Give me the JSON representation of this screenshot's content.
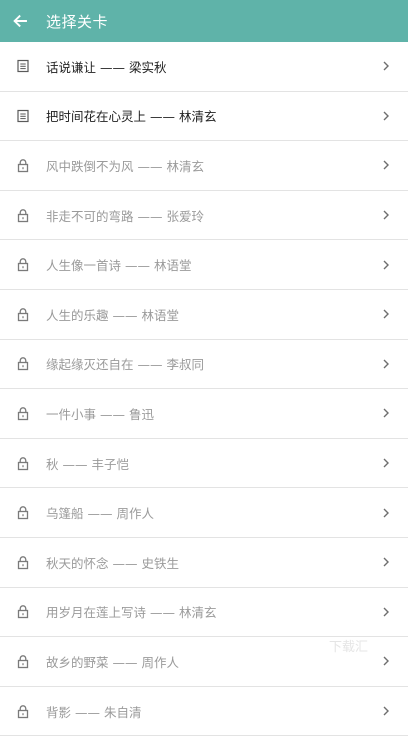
{
  "header": {
    "title": "选择关卡",
    "bg_color": "#5fb3a9"
  },
  "levels": [
    {
      "label": "话说谦让 —— 梁实秋",
      "status": "unlocked",
      "icon": "document-icon"
    },
    {
      "label": "把时间花在心灵上 —— 林清玄",
      "status": "unlocked",
      "icon": "document-icon"
    },
    {
      "label": "风中跌倒不为风 —— 林清玄",
      "status": "locked",
      "icon": "lock-icon"
    },
    {
      "label": "非走不可的弯路 —— 张爱玲",
      "status": "locked",
      "icon": "lock-icon"
    },
    {
      "label": "人生像一首诗 —— 林语堂",
      "status": "locked",
      "icon": "lock-icon"
    },
    {
      "label": "人生的乐趣 —— 林语堂",
      "status": "locked",
      "icon": "lock-icon"
    },
    {
      "label": "缘起缘灭还自在 —— 李叔同",
      "status": "locked",
      "icon": "lock-icon"
    },
    {
      "label": "一件小事 —— 鲁迅",
      "status": "locked",
      "icon": "lock-icon"
    },
    {
      "label": "秋 —— 丰子恺",
      "status": "locked",
      "icon": "lock-icon"
    },
    {
      "label": "乌篷船 —— 周作人",
      "status": "locked",
      "icon": "lock-icon"
    },
    {
      "label": "秋天的怀念 —— 史铁生",
      "status": "locked",
      "icon": "lock-icon"
    },
    {
      "label": "用岁月在莲上写诗 —— 林清玄",
      "status": "locked",
      "icon": "lock-icon"
    },
    {
      "label": "故乡的野菜 —— 周作人",
      "status": "locked",
      "icon": "lock-icon"
    },
    {
      "label": "背影 —— 朱自清",
      "status": "locked",
      "icon": "lock-icon"
    }
  ],
  "watermark": "下载汇"
}
